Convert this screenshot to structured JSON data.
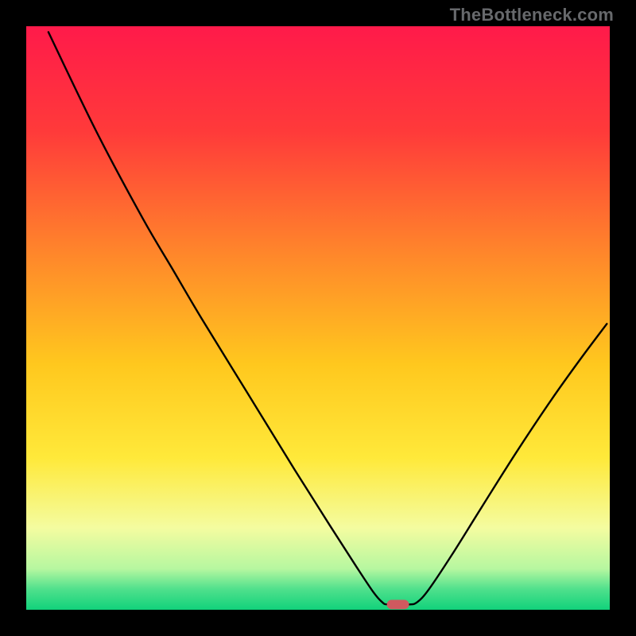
{
  "watermark": "TheBottleneck.com",
  "chart_data": {
    "type": "line",
    "title": "",
    "xlabel": "",
    "ylabel": "",
    "xlim": [
      0,
      100
    ],
    "ylim": [
      0,
      100
    ],
    "background_gradient": {
      "stops": [
        {
          "offset": 0.0,
          "color": "#ff1a4a"
        },
        {
          "offset": 0.18,
          "color": "#ff3a3a"
        },
        {
          "offset": 0.4,
          "color": "#ff8a2a"
        },
        {
          "offset": 0.58,
          "color": "#ffc81e"
        },
        {
          "offset": 0.74,
          "color": "#ffe93a"
        },
        {
          "offset": 0.86,
          "color": "#f4fca0"
        },
        {
          "offset": 0.93,
          "color": "#b6f7a0"
        },
        {
          "offset": 0.965,
          "color": "#4fe08c"
        },
        {
          "offset": 1.0,
          "color": "#11d27b"
        }
      ]
    },
    "curve_points": [
      {
        "x": 3.8,
        "y": 99.0
      },
      {
        "x": 12.0,
        "y": 82.0
      },
      {
        "x": 20.0,
        "y": 67.0
      },
      {
        "x": 25.0,
        "y": 58.5
      },
      {
        "x": 30.0,
        "y": 50.0
      },
      {
        "x": 38.0,
        "y": 37.0
      },
      {
        "x": 46.0,
        "y": 24.0
      },
      {
        "x": 52.0,
        "y": 14.5
      },
      {
        "x": 56.5,
        "y": 7.5
      },
      {
        "x": 59.5,
        "y": 3.0
      },
      {
        "x": 61.0,
        "y": 1.3
      },
      {
        "x": 62.0,
        "y": 0.9
      },
      {
        "x": 65.5,
        "y": 0.9
      },
      {
        "x": 67.0,
        "y": 1.3
      },
      {
        "x": 69.0,
        "y": 3.5
      },
      {
        "x": 73.0,
        "y": 9.5
      },
      {
        "x": 78.0,
        "y": 17.5
      },
      {
        "x": 84.0,
        "y": 27.0
      },
      {
        "x": 90.0,
        "y": 36.0
      },
      {
        "x": 95.0,
        "y": 43.0
      },
      {
        "x": 99.5,
        "y": 49.0
      }
    ],
    "marker": {
      "x": 63.7,
      "y": 0.9,
      "width": 3.8,
      "height": 1.6,
      "color": "#d0595f"
    }
  }
}
